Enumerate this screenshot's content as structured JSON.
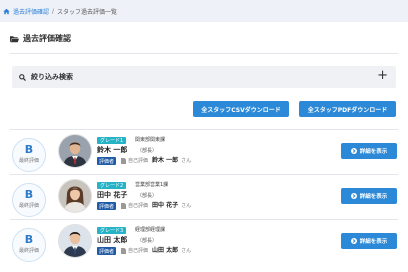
{
  "breadcrumb": {
    "link": "過去評価確認",
    "separator": "/",
    "current": "スタッフ過去評価一覧"
  },
  "page": {
    "title": "過去評価確認"
  },
  "filter": {
    "label": "絞り込み検索",
    "toggle": "+"
  },
  "downloads": {
    "csv": "全スタッフCSVダウンロード",
    "pdf": "全スタッフPDFダウンロード"
  },
  "staff": [
    {
      "grade": "B",
      "grade_caption": "最終評価",
      "grade_badge": "グレード1",
      "dept": "関東部関東課",
      "name": "鈴木 一郎",
      "role": "（部長）",
      "eval_badge": "評価者",
      "self_label": "自己評価",
      "evaluator": "鈴木 一郎",
      "san": "さん",
      "detail": "詳細を表示"
    },
    {
      "grade": "B",
      "grade_caption": "最終評価",
      "grade_badge": "グレード2",
      "dept": "営業部営業1課",
      "name": "田中 花子",
      "role": "（部長）",
      "eval_badge": "評価者",
      "self_label": "自己評価",
      "evaluator": "田中 花子",
      "san": "さん",
      "detail": "詳細を表示"
    },
    {
      "grade": "B",
      "grade_caption": "最終評価",
      "grade_badge": "グレード3",
      "dept": "経理部経理課",
      "name": "山田 太郎",
      "role": "（部長）",
      "eval_badge": "評価者",
      "self_label": "自己評価",
      "evaluator": "山田 太郎",
      "san": "さん",
      "detail": "詳細を表示"
    }
  ],
  "colors": {
    "accent": "#2b89d8",
    "grade_badge": "#27b3c6",
    "eval_badge": "#1e5aa6",
    "grade_letter": "#2d7bc9"
  }
}
